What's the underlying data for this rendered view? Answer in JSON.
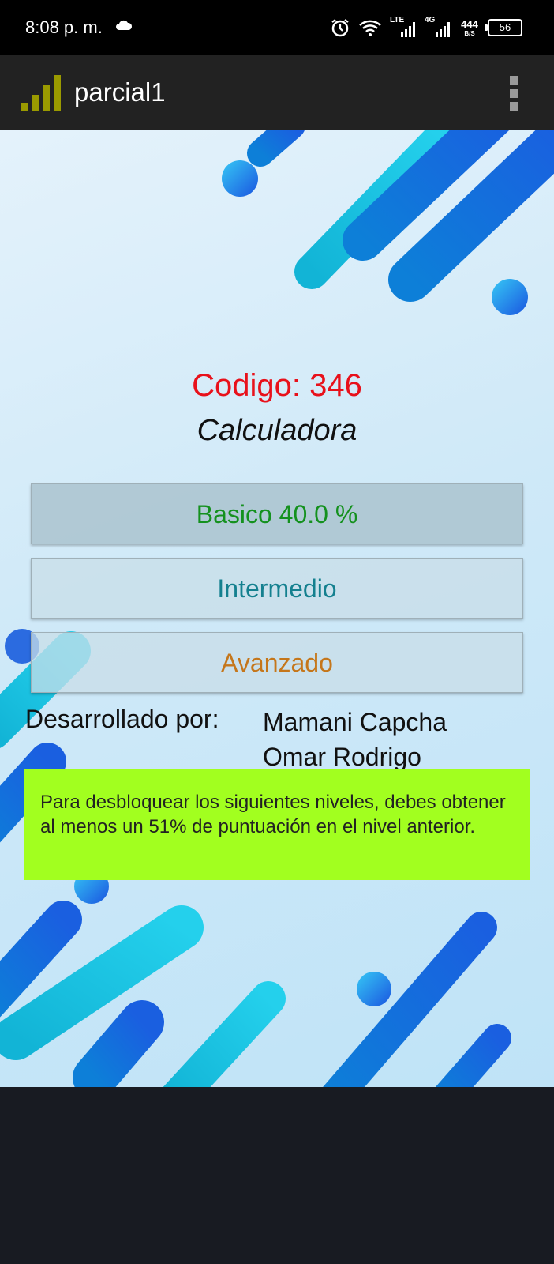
{
  "status_bar": {
    "time": "8:08 p. m.",
    "icons": [
      "cloud-icon",
      "alarm-icon",
      "wifi-icon",
      "lte-signal-icon",
      "4g-signal-icon",
      "network-speed-icon",
      "battery-icon"
    ],
    "lte_label": "LTE",
    "fourg_label": "4G",
    "speed_value": "444",
    "speed_unit": "B/S",
    "battery_level": "56"
  },
  "app_bar": {
    "title": "parcial1",
    "logo_icon": "signal-bars-logo-icon",
    "menu_icon": "overflow-menu-icon"
  },
  "main": {
    "codigo": "Codigo: 346",
    "subtitle": "Calculadora",
    "levels": [
      {
        "label": "Basico  40.0 %",
        "color": "#14911e"
      },
      {
        "label": "Intermedio",
        "color": "#14808f"
      },
      {
        "label": "Avanzado",
        "color": "#c5761a"
      }
    ],
    "developer_label": "Desarrollado por:",
    "developer_name_line1": "Mamani Capcha",
    "developer_name_line2": "Omar Rodrigo",
    "note": "Para desbloquear los siguientes niveles, debes obtener al menos un 51% de puntuación en el nivel anterior."
  },
  "colors": {
    "codigo": "#e8111b",
    "note_background": "#a2ff1f",
    "app_bar": "#222222",
    "logo": "#9a9a00"
  }
}
